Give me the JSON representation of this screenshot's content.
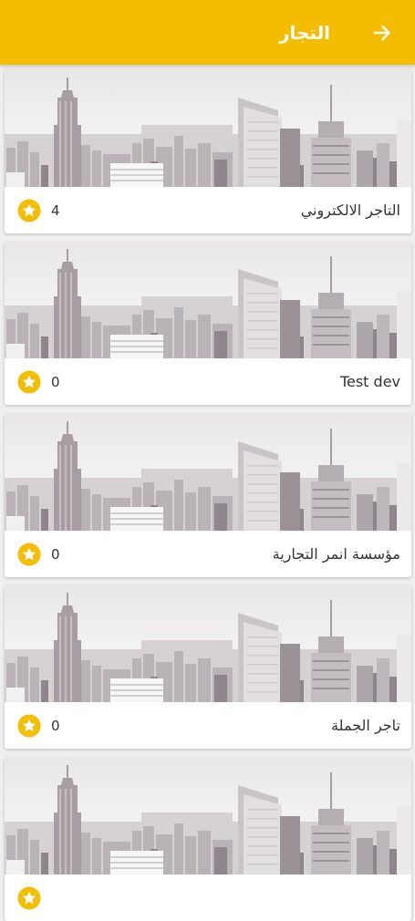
{
  "app": {
    "title": "التجار",
    "accent_color": "#f5bd00",
    "back_icon": "arrow-right-icon"
  },
  "merchants": [
    {
      "name": "التاجر الالكتروني",
      "rating": "4",
      "image": "city-skyline-image",
      "icon": "star-icon"
    },
    {
      "name": "Test dev",
      "rating": "0",
      "image": "city-skyline-image",
      "icon": "star-icon"
    },
    {
      "name": "مؤسسة انمر التجارية",
      "rating": "0",
      "image": "city-skyline-image",
      "icon": "star-icon"
    },
    {
      "name": "تاجر الجملة",
      "rating": "0",
      "image": "city-skyline-image",
      "icon": "star-icon"
    },
    {
      "name": "",
      "rating": "",
      "image": "city-skyline-image",
      "icon": "star-icon"
    }
  ]
}
